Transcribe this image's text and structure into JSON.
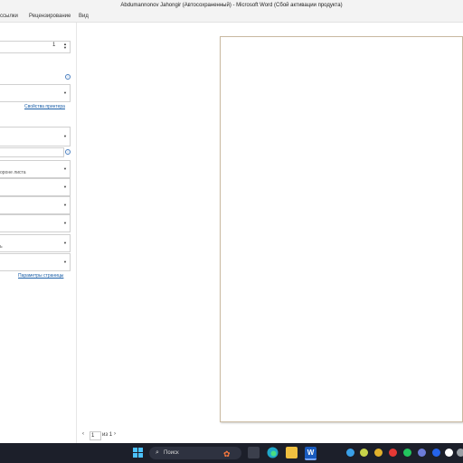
{
  "window": {
    "title": "Abdumannonov Jahongir (Автосохраненный)  -  Microsoft Word (Сбой активации продукта)"
  },
  "menu": {
    "items": [
      "ссылки",
      "Рецензирование",
      "Вид"
    ]
  },
  "print_panel": {
    "copies_value": "1",
    "printer_properties_link": "Свойства принтера",
    "duplex_hint": "ороне листа",
    "orientation_hint": "ь",
    "page_setup_link": "Параметры страницы"
  },
  "pager": {
    "current": "1",
    "of_text": "из 1"
  },
  "taskbar": {
    "search_placeholder": "Поиск",
    "pinned": [
      "start-icon",
      "search-icon",
      "task-view-icon",
      "edge-icon",
      "file-explorer-icon",
      "word-icon"
    ],
    "tray": [
      "onedrive-icon",
      "app-icon",
      "app-icon",
      "opera-icon",
      "app-icon",
      "app-icon",
      "bluetooth-icon",
      "yandex-icon",
      "app-icon"
    ]
  },
  "colors": {
    "accent": "#1b5fa8",
    "taskbar": "#1c1f2a",
    "word_blue": "#185abd"
  }
}
